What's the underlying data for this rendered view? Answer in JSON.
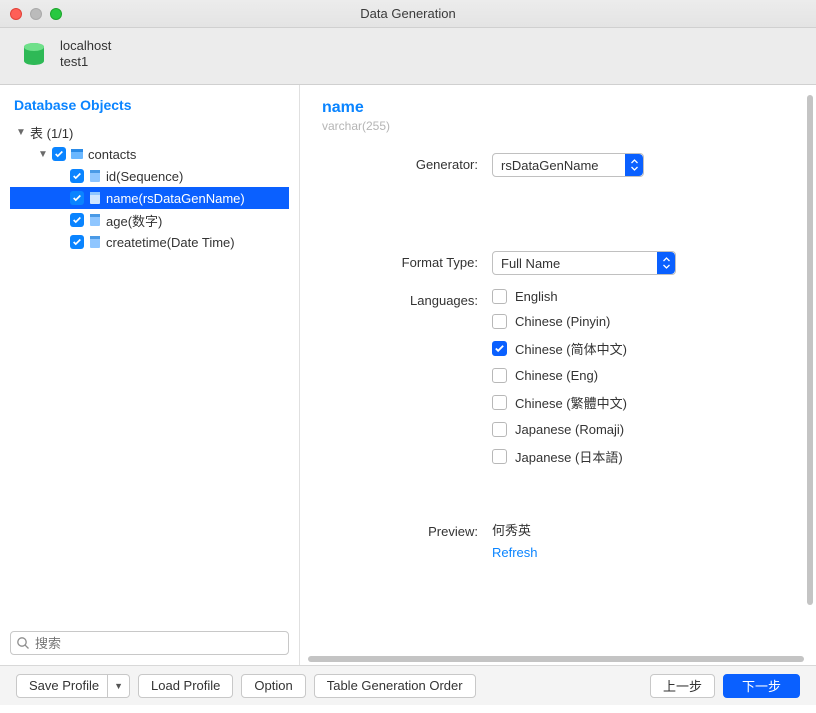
{
  "window": {
    "title": "Data Generation"
  },
  "header": {
    "host": "localhost",
    "db": "test1"
  },
  "sidebar": {
    "title": "Database Objects",
    "search_placeholder": "搜索",
    "root": {
      "label": "表 (1/1)"
    },
    "table": {
      "label": "contacts"
    },
    "columns": [
      {
        "label": "id(Sequence)"
      },
      {
        "label": "name(rsDataGenName)"
      },
      {
        "label": "age(数字)"
      },
      {
        "label": "createtime(Date Time)"
      }
    ]
  },
  "detail": {
    "title": "name",
    "subtype": "varchar(255)",
    "generator_label": "Generator:",
    "generator_value": "rsDataGenName",
    "format_label": "Format Type:",
    "format_value": "Full Name",
    "languages_label": "Languages:",
    "languages": [
      {
        "label": "English",
        "checked": false
      },
      {
        "label": "Chinese (Pinyin)",
        "checked": false
      },
      {
        "label": "Chinese (简体中文)",
        "checked": true
      },
      {
        "label": "Chinese (Eng)",
        "checked": false
      },
      {
        "label": "Chinese (繁體中文)",
        "checked": false
      },
      {
        "label": "Japanese (Romaji)",
        "checked": false
      },
      {
        "label": "Japanese (日本語)",
        "checked": false
      }
    ],
    "preview_label": "Preview:",
    "preview_value": "何秀英",
    "refresh_label": "Refresh"
  },
  "footer": {
    "save_profile": "Save Profile",
    "load_profile": "Load Profile",
    "option": "Option",
    "table_order": "Table Generation Order",
    "prev": "上一步",
    "next": "下一步"
  }
}
